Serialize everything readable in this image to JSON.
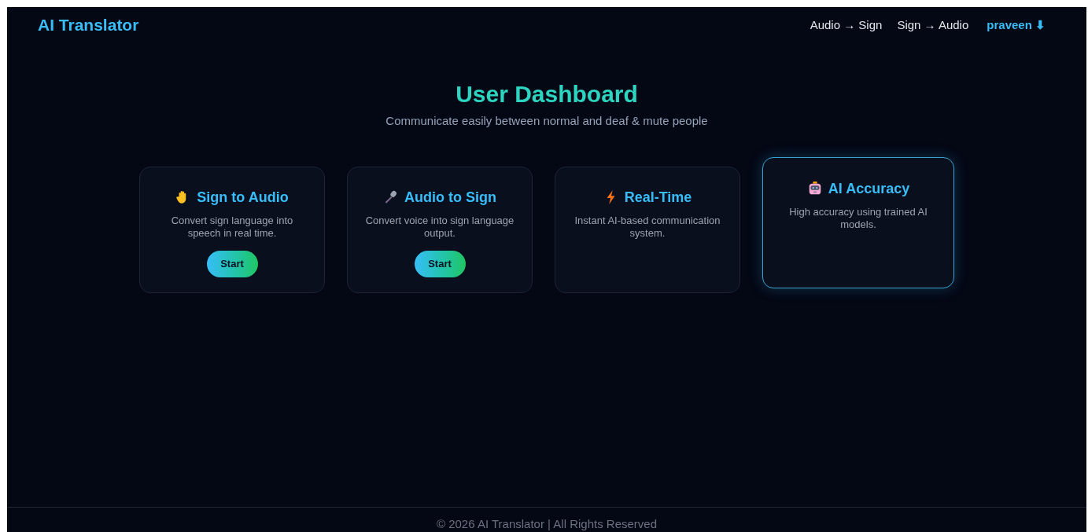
{
  "brand": "AI Translator",
  "nav": [
    {
      "label": "Audio → Sign",
      "kind": "link"
    },
    {
      "label": "Sign → Audio",
      "kind": "link"
    },
    {
      "label": "praveen ⬇",
      "kind": "user"
    }
  ],
  "title": "User Dashboard",
  "subtitle": "Communicate easily between normal and deaf & mute people",
  "cards": [
    {
      "kind": "hand",
      "title": "Sign to Audio",
      "text": "Convert sign language into speech in real time.",
      "button": "Start",
      "highlighted": false
    },
    {
      "kind": "microphone",
      "title": "Audio to Sign",
      "text": "Convert voice into sign language output.",
      "button": "Start",
      "highlighted": false
    },
    {
      "kind": "lightning",
      "title": "Real-Time",
      "text": "Instant AI-based communication system.",
      "highlighted": false
    },
    {
      "kind": "robot",
      "title": "AI Accuracy",
      "text": "High accuracy using trained AI models.",
      "highlighted": true
    }
  ],
  "footer": "© 2026 AI Translator | All Rights Reserved"
}
